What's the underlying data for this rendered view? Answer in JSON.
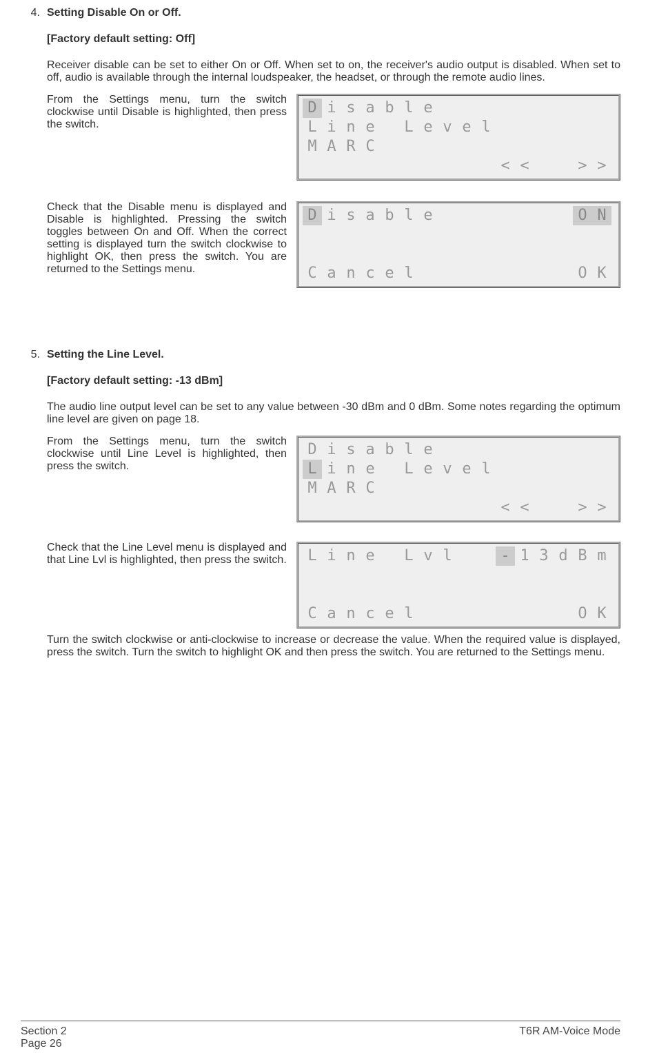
{
  "sections": [
    {
      "num": "4.",
      "title": "Setting Disable On or Off.",
      "default": "[Factory default setting:  Off]",
      "intro": "Receiver disable can be set to either On or Off. When set to on, the receiver's audio output is disabled. When set to off, audio is available through the internal loudspeaker, the headset, or through the remote audio lines.",
      "steps": [
        {
          "text": "From the Settings menu, turn the switch clockwise until Disable is highlighted, then press the switch."
        },
        {
          "text": "Check that the Disable menu is displayed and Disable is highlighted. Pressing the switch toggles between On and Off. When the correct setting is displayed turn the switch clockwise to highlight OK, then press the switch. You are returned to the Settings menu."
        }
      ]
    },
    {
      "num": "5.",
      "title": "Setting the Line Level.",
      "default": "[Factory default setting:  -13 dBm]",
      "intro": "The audio line output level can be set to any value between -30 dBm and 0 dBm. Some notes regarding the optimum line level are given on page 18.",
      "steps": [
        {
          "text": "From the Settings menu, turn the switch clockwise until Line Level is highlighted, then press the switch."
        },
        {
          "text": "Check that the Line Level menu is displayed and that Line Lvl is highlighted, then press the switch."
        },
        {
          "text2": "Turn the switch clockwise or anti-clockwise to increase or decrease the value. When the required value is displayed, press the switch. Turn the switch to highlight OK and then press the switch. You are returned to the Settings menu."
        }
      ]
    }
  ],
  "lcd": {
    "screen1": {
      "r1": [
        "D",
        "i",
        "s",
        "a",
        "b",
        "l",
        "e",
        "",
        "",
        "",
        "",
        "",
        "",
        "",
        "",
        ""
      ],
      "r1_hl": [
        true,
        false,
        false,
        false,
        false,
        false,
        false,
        false,
        false,
        false,
        false,
        false,
        false,
        false,
        false,
        false
      ],
      "r2": [
        "L",
        "i",
        "n",
        "e",
        "",
        "L",
        "e",
        "v",
        "e",
        "l",
        "",
        "",
        "",
        "",
        "",
        ""
      ],
      "r3": [
        "M",
        "A",
        "R",
        "C",
        "",
        "",
        "",
        "",
        "",
        "",
        "",
        "",
        "",
        "",
        "",
        ""
      ],
      "r4": [
        "",
        "",
        "",
        "",
        "",
        "",
        "",
        "",
        "",
        "",
        "<",
        "<",
        "",
        "",
        ">",
        ">"
      ]
    },
    "screen2": {
      "r1": [
        "D",
        "i",
        "s",
        "a",
        "b",
        "l",
        "e",
        "",
        "",
        "",
        "",
        "",
        "",
        "",
        "O",
        "N"
      ],
      "r1_hl": [
        true,
        false,
        false,
        false,
        false,
        false,
        false,
        false,
        false,
        false,
        false,
        false,
        false,
        false,
        true,
        true
      ],
      "r2": [
        "",
        "",
        "",
        "",
        "",
        "",
        "",
        "",
        "",
        "",
        "",
        "",
        "",
        "",
        "",
        ""
      ],
      "r3": [
        "",
        "",
        "",
        "",
        "",
        "",
        "",
        "",
        "",
        "",
        "",
        "",
        "",
        "",
        "",
        ""
      ],
      "r4": [
        "C",
        "a",
        "n",
        "c",
        "e",
        "l",
        "",
        "",
        "",
        "",
        "",
        "",
        "",
        "",
        "O",
        "K"
      ]
    },
    "screen3": {
      "r1": [
        "D",
        "i",
        "s",
        "a",
        "b",
        "l",
        "e",
        "",
        "",
        "",
        "",
        "",
        "",
        "",
        "",
        ""
      ],
      "r2": [
        "L",
        "i",
        "n",
        "e",
        "",
        "L",
        "e",
        "v",
        "e",
        "l",
        "",
        "",
        "",
        "",
        "",
        ""
      ],
      "r2_hl": [
        true,
        false,
        false,
        false,
        false,
        false,
        false,
        false,
        false,
        false,
        false,
        false,
        false,
        false,
        false,
        false
      ],
      "r3": [
        "M",
        "A",
        "R",
        "C",
        "",
        "",
        "",
        "",
        "",
        "",
        "",
        "",
        "",
        "",
        "",
        ""
      ],
      "r4": [
        "",
        "",
        "",
        "",
        "",
        "",
        "",
        "",
        "",
        "",
        "<",
        "<",
        "",
        "",
        ">",
        ">"
      ]
    },
    "screen4": {
      "r1": [
        "L",
        "i",
        "n",
        "e",
        "",
        "L",
        "v",
        "l",
        "",
        "",
        "-",
        "1",
        "3",
        "d",
        "B",
        "m"
      ],
      "r1_hl": [
        false,
        false,
        false,
        false,
        false,
        false,
        false,
        false,
        false,
        false,
        true,
        false,
        false,
        false,
        false,
        false
      ],
      "r2": [
        "",
        "",
        "",
        "",
        "",
        "",
        "",
        "",
        "",
        "",
        "",
        "",
        "",
        "",
        "",
        ""
      ],
      "r3": [
        "",
        "",
        "",
        "",
        "",
        "",
        "",
        "",
        "",
        "",
        "",
        "",
        "",
        "",
        "",
        ""
      ],
      "r4": [
        "C",
        "a",
        "n",
        "c",
        "e",
        "l",
        "",
        "",
        "",
        "",
        "",
        "",
        "",
        "",
        "O",
        "K"
      ]
    }
  },
  "footer": {
    "left1": "Section 2",
    "left2": "Page 26",
    "right": "T6R AM-Voice Mode"
  }
}
